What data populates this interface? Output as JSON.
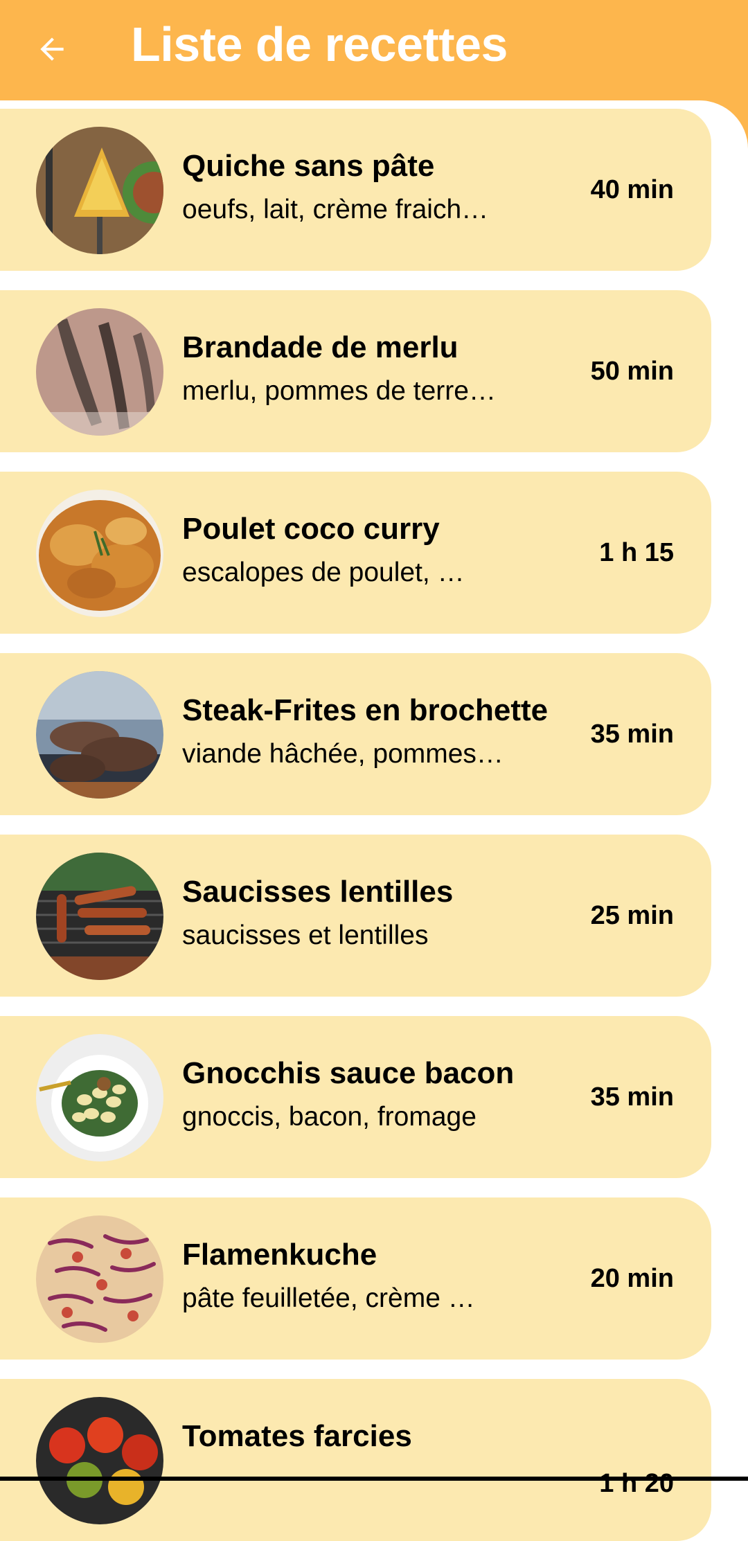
{
  "header": {
    "title": "Liste de recettes",
    "back_icon": "arrow-left-icon"
  },
  "colors": {
    "appbar": "#FDB64D",
    "card": "#FCE9B0",
    "text": "#000000"
  },
  "recipes": [
    {
      "name": "Quiche sans pâte",
      "ingredients": "oeufs, lait, crème fraich…",
      "time": "40 min",
      "image": "quiche-image"
    },
    {
      "name": "Brandade de merlu",
      "ingredients": "merlu, pommes de terre…",
      "time": "50 min",
      "image": "fish-image"
    },
    {
      "name": "Poulet coco curry",
      "ingredients": "escalopes de poulet, …",
      "time": "1 h 15",
      "image": "roast-chicken-image"
    },
    {
      "name": "Steak-Frites en brochette",
      "ingredients": "viande hâchée, pommes…",
      "time": "35 min",
      "image": "grilled-steak-image"
    },
    {
      "name": "Saucisses lentilles",
      "ingredients": "saucisses et lentilles",
      "time": "25 min",
      "image": "grilled-sausages-image"
    },
    {
      "name": "Gnocchis sauce bacon",
      "ingredients": "gnoccis, bacon, fromage",
      "time": "35 min",
      "image": "gnocchi-plate-image"
    },
    {
      "name": "Flamenkuche",
      "ingredients": "pâte feuilletée, crème …",
      "time": "20 min",
      "image": "flammekueche-image"
    },
    {
      "name": "Tomates farcies",
      "ingredients": "",
      "time": "1 h 20",
      "image": "stuffed-tomatoes-image"
    }
  ]
}
